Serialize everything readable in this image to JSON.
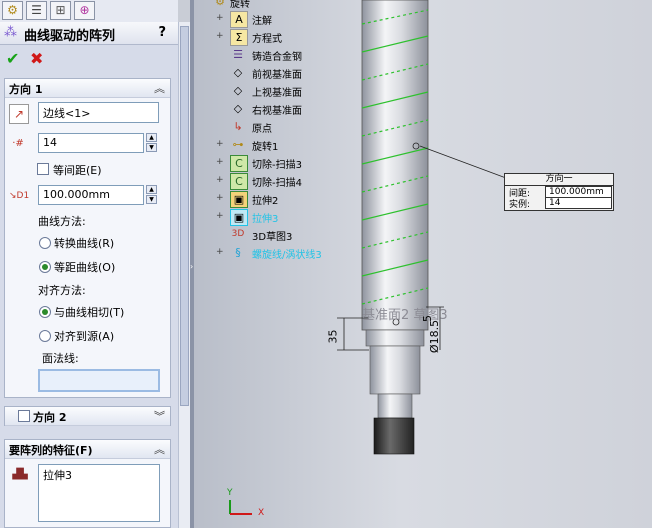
{
  "panel": {
    "title": "曲线驱动的阵列",
    "help": "?",
    "tabs": [
      "feature-manager-tab",
      "property-manager-tab",
      "configuration-manager-tab",
      "dimxpert-tab"
    ],
    "direction1": {
      "label": "方向 1",
      "edge_value": "边线<1>",
      "instances": "14",
      "equal_spacing_label": "等间距(E)",
      "spacing": "100.000mm",
      "curve_method_label": "曲线方法:",
      "transform_curve": "转换曲线(R)",
      "offset_curve": "等距曲线(O)",
      "align_method_label": "对齐方法:",
      "tangent_to_curve": "与曲线相切(T)",
      "align_to_source": "对齐到源(A)",
      "face_normal_label": "面法线:"
    },
    "direction2": {
      "label": "方向 2"
    },
    "features": {
      "label": "要阵列的特征(F)",
      "items": [
        "拉伸3"
      ]
    }
  },
  "tree": {
    "top": "旋转",
    "items": [
      {
        "label": "注解",
        "color": "#000000",
        "expand": "+"
      },
      {
        "label": "方程式",
        "color": "#000000",
        "expand": "+"
      },
      {
        "label": "铸造合金钢",
        "color": "#000000",
        "expand": ""
      },
      {
        "label": "前视基准面",
        "color": "#000000",
        "expand": ""
      },
      {
        "label": "上视基准面",
        "color": "#000000",
        "expand": ""
      },
      {
        "label": "右视基准面",
        "color": "#000000",
        "expand": ""
      },
      {
        "label": "原点",
        "color": "#000000",
        "expand": ""
      },
      {
        "label": "旋转1",
        "color": "#000000",
        "expand": "+"
      },
      {
        "label": "切除-扫描3",
        "color": "#000000",
        "expand": "+"
      },
      {
        "label": "切除-扫描4",
        "color": "#000000",
        "expand": "+"
      },
      {
        "label": "拉伸2",
        "color": "#000000",
        "expand": "+"
      },
      {
        "label": "拉伸3",
        "color": "#22c3e6",
        "expand": "+"
      },
      {
        "label": "3D草图3",
        "color": "#000000",
        "expand": ""
      },
      {
        "label": "螺旋线/涡状线3",
        "color": "#22c3e6",
        "expand": "+"
      }
    ]
  },
  "callout": {
    "title": "方向一",
    "spacing_label": "间距:",
    "spacing_value": "100.000mm",
    "instances_label": "实例:",
    "instances_value": "14"
  },
  "view": {
    "sketch_label": "基准面2 草图3",
    "dim_35": "35",
    "dim_5": "5",
    "dim_18": "18",
    "dim_dia": "Ø18.5",
    "axis_x": "X",
    "axis_y": "Y"
  }
}
